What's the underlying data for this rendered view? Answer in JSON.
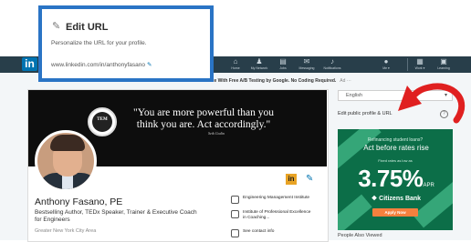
{
  "callout": {
    "title": "Edit URL",
    "subtitle": "Personalize the URL for your profile.",
    "url": "www.linkedin.com/in/anthonyfasano"
  },
  "nav": {
    "logo": "in",
    "items": [
      {
        "label": "Home",
        "icon": "home-icon"
      },
      {
        "label": "My Network",
        "icon": "network-icon"
      },
      {
        "label": "Jobs",
        "icon": "jobs-icon"
      },
      {
        "label": "Messaging",
        "icon": "messaging-icon"
      },
      {
        "label": "Notifications",
        "icon": "bell-icon"
      },
      {
        "label": "Me ▾",
        "icon": "avatar-icon"
      },
      {
        "label": "Work ▾",
        "icon": "grid-icon"
      },
      {
        "label": "Learning",
        "icon": "learning-icon"
      }
    ]
  },
  "ad_line": {
    "text": "ate With Free A/B Testing by Google. No Coding Required.",
    "tag": "Ad ···"
  },
  "banner": {
    "quote_line1": "\"You are more powerful than you",
    "quote_line2": "think you are. Act accordingly.\"",
    "quote_author": "Seth Godin",
    "seal_text": "TEM"
  },
  "profile": {
    "name": "Anthony Fasano, PE",
    "headline": "Bestselling Author, TEDx Speaker, Trainer & Executive Coach for Engineers",
    "location": "Greater New York City Area",
    "badge": "in",
    "affiliations": [
      "Engineering Management Institute",
      "Institute of Professional Excellence in Coaching...",
      "See contact info"
    ]
  },
  "right": {
    "language": "English",
    "edit_public": "Edit public profile & URL",
    "help": "?",
    "also_viewed": "People Also Viewed"
  },
  "bank_ad": {
    "line1": "Refinancing student loans?",
    "line2": "Act before rates rise",
    "line3": "Fixed rates as low as",
    "rate": "3.75%",
    "rate_suffix": "APR",
    "bank": "Citizens Bank",
    "button": "Apply Now"
  },
  "colors": {
    "accent_blue": "#2a74c5",
    "linkedin_nav": "#283e4a",
    "arrow_red": "#e02020",
    "ad_green": "#0c6e48"
  }
}
